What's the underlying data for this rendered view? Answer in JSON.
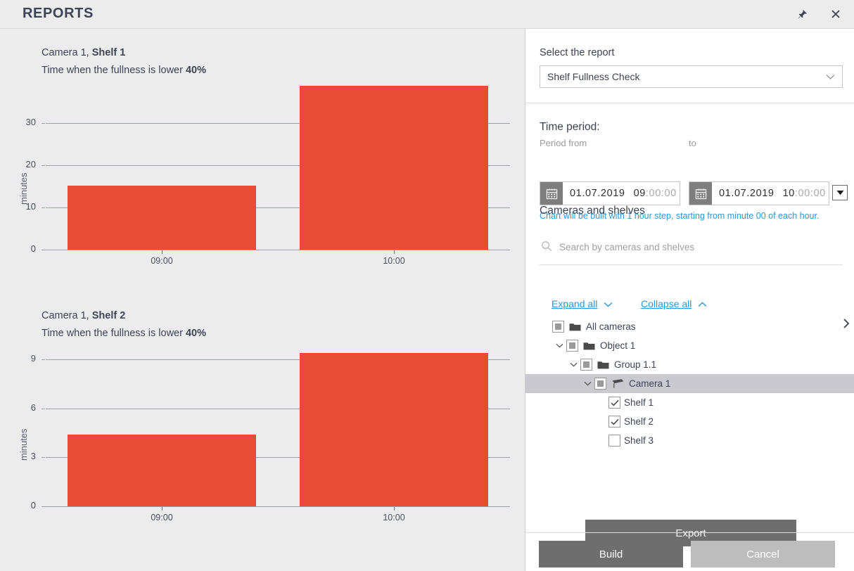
{
  "window": {
    "title": "REPORTS",
    "pin_icon": "pin-icon",
    "close_icon": "close-icon",
    "edge_icon": "chevron-right-icon"
  },
  "charts": [
    {
      "heading_prefix": "Camera 1, ",
      "heading_bold": "Shelf 1",
      "subtitle_prefix": "Time when the fullness is lower ",
      "subtitle_bold": "40%"
    },
    {
      "heading_prefix": "Camera 1, ",
      "heading_bold": "Shelf 2",
      "subtitle_prefix": "Time when the fullness is lower ",
      "subtitle_bold": "40%"
    }
  ],
  "chart_data": [
    {
      "type": "bar",
      "title": "Camera 1, Shelf 1",
      "subtitle": "Time when the fullness is lower 40%",
      "categories": [
        "09:00",
        "10:00"
      ],
      "values": [
        15.2,
        38.8
      ],
      "xlabel": "",
      "ylabel": "minutes",
      "ylim": [
        0,
        40
      ],
      "yticks": [
        0,
        10,
        20,
        30
      ],
      "grid": true,
      "legend": "none",
      "bar_color": "#e84c35"
    },
    {
      "type": "bar",
      "title": "Camera 1, Shelf 2",
      "subtitle": "Time when the fullness is lower 40%",
      "categories": [
        "09:00",
        "10:00"
      ],
      "values": [
        4.4,
        9.4
      ],
      "xlabel": "",
      "ylabel": "minutes",
      "ylim": [
        0,
        9.6
      ],
      "yticks": [
        0,
        3,
        6,
        9
      ],
      "grid": true,
      "legend": "none",
      "bar_color": "#e84c35"
    }
  ],
  "panel": {
    "select_report_label": "Select the report",
    "selected_report": "Shelf Fullness Check",
    "time_period_label": "Time period:",
    "period_from_label": "Period from",
    "period_to_label": "to",
    "from_date": "01.07.2019",
    "from_time_hm": "09",
    "from_time_rest": ":00:00",
    "to_date": "01.07.2019",
    "to_time_hm": "10",
    "to_time_rest": ":00:00",
    "hint": "Chart will be built with 1 hour step, starting from minute 00 of each hour.",
    "cameras_label": "Cameras and shelves",
    "search_placeholder": "Search by cameras and shelves",
    "expand_all": "Expand all",
    "collapse_all": "Collapse all",
    "export_label": "Export"
  },
  "tree": [
    {
      "label": "All cameras",
      "indent": 0,
      "twisty": "none",
      "check": "partial",
      "icon": "folder-icon",
      "selected": false
    },
    {
      "label": "Object 1",
      "indent": 1,
      "twisty": "down",
      "check": "partial",
      "icon": "folder-icon",
      "selected": false
    },
    {
      "label": "Group 1.1",
      "indent": 2,
      "twisty": "down",
      "check": "partial",
      "icon": "folder-icon",
      "selected": false
    },
    {
      "label": "Camera 1",
      "indent": 3,
      "twisty": "down",
      "check": "partial",
      "icon": "camera-icon",
      "selected": true
    },
    {
      "label": "Shelf 1",
      "indent": 4,
      "twisty": "none",
      "check": "checked",
      "icon": "none",
      "selected": false
    },
    {
      "label": "Shelf 2",
      "indent": 4,
      "twisty": "none",
      "check": "checked",
      "icon": "none",
      "selected": false
    },
    {
      "label": "Shelf 3",
      "indent": 4,
      "twisty": "none",
      "check": "unchecked",
      "icon": "none",
      "selected": false
    }
  ],
  "footer": {
    "build_label": "Build",
    "cancel_label": "Cancel"
  },
  "colors": {
    "bar": "#e84c35",
    "link": "#2c97d4",
    "panel_bg": "#ffffff",
    "app_bg": "#ececec",
    "button": "#6e6e6e",
    "button_disabled": "#bdbdbd",
    "text": "#3d4456"
  }
}
